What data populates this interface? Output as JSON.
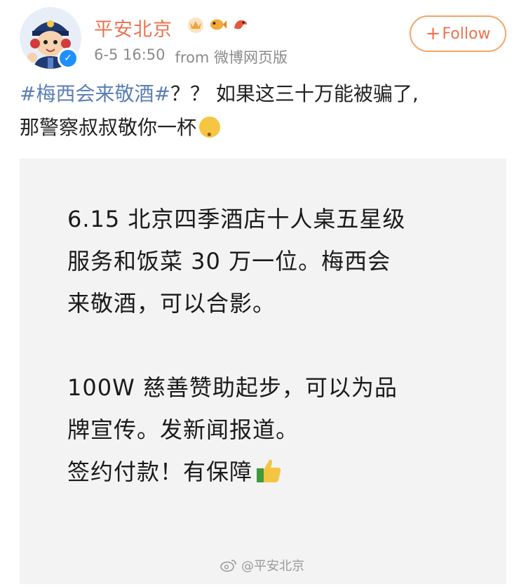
{
  "header": {
    "username": "平安北京",
    "timestamp": "6-5 16:50",
    "source": "from 微博网页版",
    "badges": [
      "crown-badge",
      "fish-badge",
      "bird-badge"
    ],
    "follow_label": "Follow"
  },
  "post": {
    "hashtag": "#梅西会来敬酒#",
    "text_line1_rest": "？？ 如果这三十万能被骗了,",
    "text_line2": "那警察叔叔敬你一杯"
  },
  "image": {
    "lines": [
      "6.15 北京四季酒店十人桌五星级",
      "服务和饭菜 30 万一位。梅西会",
      "来敬酒，可以合影。",
      "100W 慈善赞助起步，可以为品",
      "牌宣传。发新闻报道。",
      "签约付款！有保障"
    ],
    "watermark": "@平安北京"
  },
  "colors": {
    "accent": "#eb7350",
    "hashtag": "#5b7fb5",
    "meta": "#8a8a8a",
    "verified": "#1e90ff"
  }
}
